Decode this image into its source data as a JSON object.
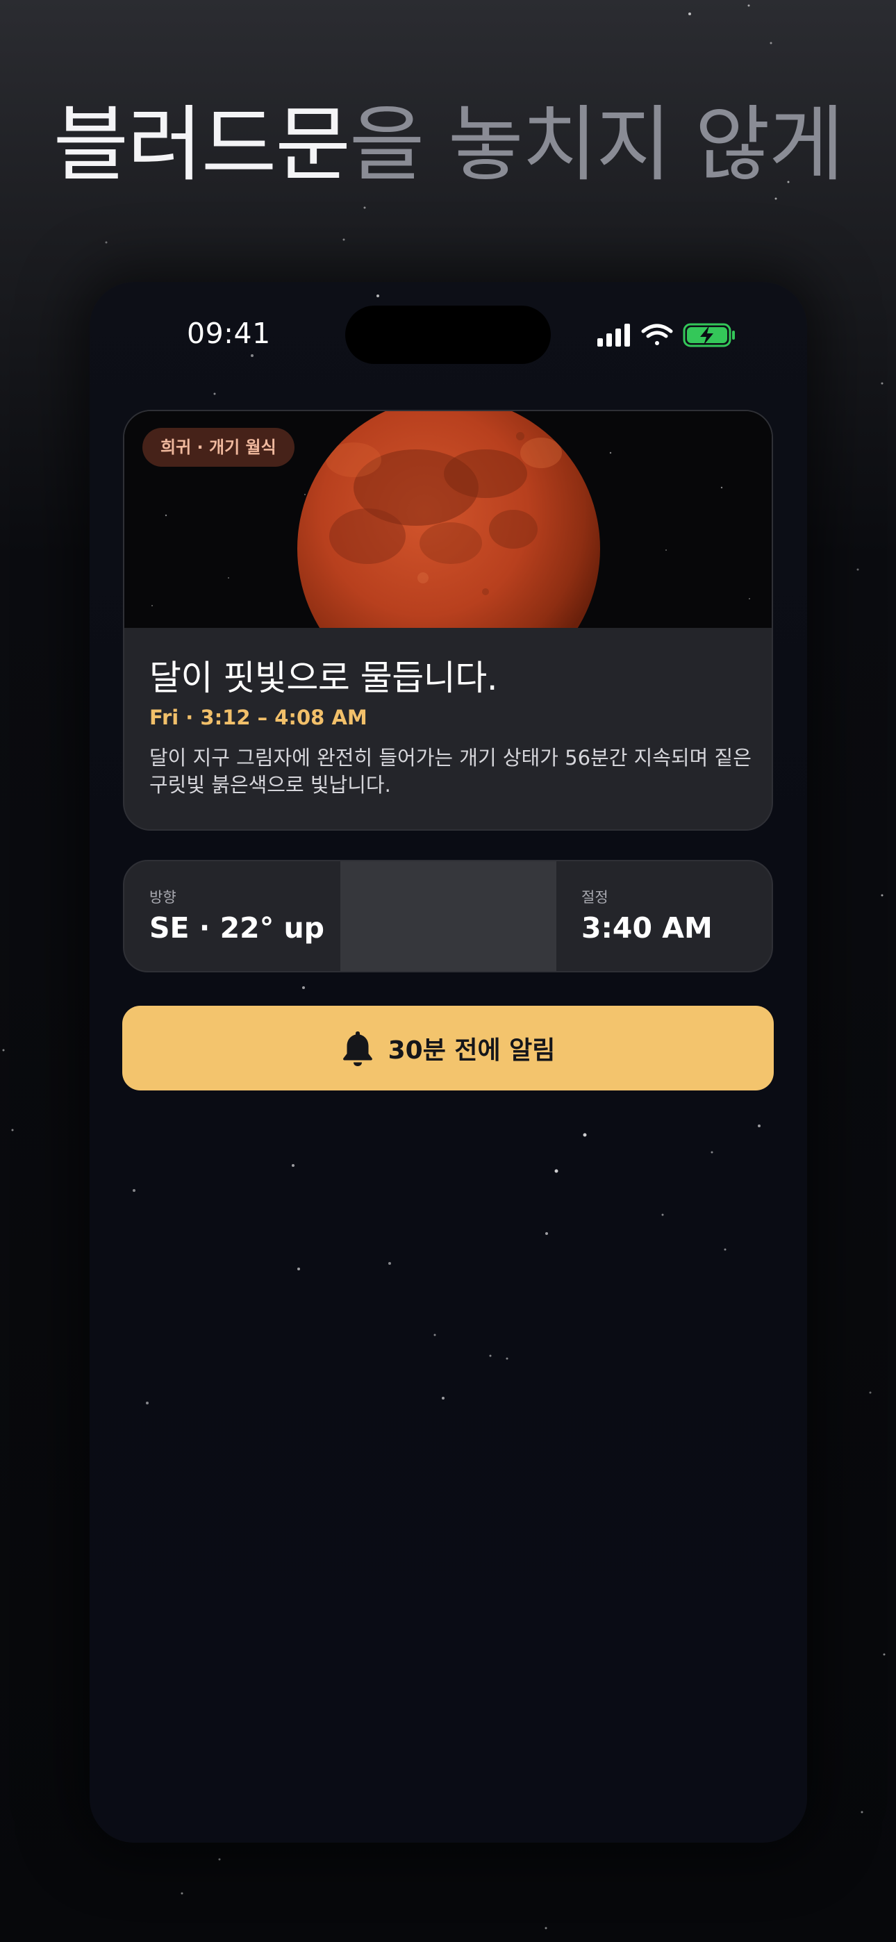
{
  "headline": {
    "highlight": "블러드문",
    "rest": "을 놓치지 않게"
  },
  "status_bar": {
    "time": "09:41",
    "icons": [
      "cellular-signal-icon",
      "wifi-icon",
      "battery-charging-icon"
    ],
    "battery_color": "#34c759"
  },
  "event_card": {
    "tag": "희귀 · 개기 월식",
    "title": "달이 핏빛으로 물듭니다.",
    "time": "Fri · 3:12 – 4:08 AM",
    "description": "달이 지구 그림자에 완전히 들어가는 개기 상태가 56분간 지속되며 짙은 구릿빛 붉은색으로 빛납니다."
  },
  "info": {
    "direction_label": "방향",
    "direction_value": "SE · 22° up",
    "peak_label": "절정",
    "peak_value": "3:40 AM"
  },
  "alarm_button": {
    "label": "30분 전에 알림",
    "icon": "bell-icon"
  },
  "colors": {
    "accent": "#f3c46d",
    "time_accent": "#f2c06a",
    "card_bg": "#24252a",
    "screen_bg": "#0a0c14"
  }
}
